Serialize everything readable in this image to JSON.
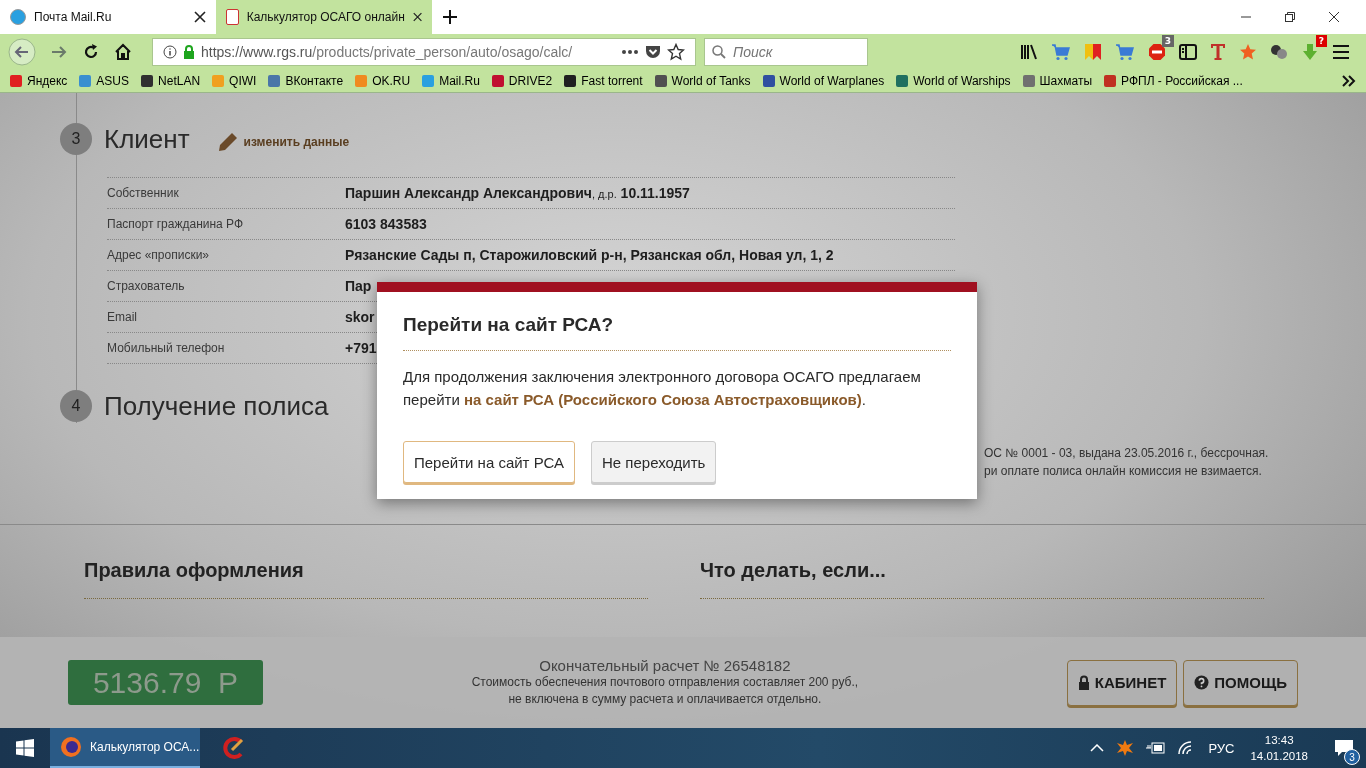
{
  "browser": {
    "tabs": [
      {
        "title": "Почта Mail.Ru",
        "selected": false
      },
      {
        "title": "Калькулятор ОСАГО онлайн",
        "selected": true
      }
    ],
    "url_host": "https://www.rgs.ru",
    "url_path": "/products/private_person/auto/osago/calc/",
    "search": {
      "placeholder": "Поиск"
    },
    "toolbar_badges": [
      {
        "text": "3"
      },
      {
        "text": "?"
      }
    ],
    "bookmarks": [
      {
        "label": "Яндекс",
        "color": "#e02020"
      },
      {
        "label": "ASUS",
        "color": "#3a8fd0"
      },
      {
        "label": "NetLAN",
        "color": "#303030"
      },
      {
        "label": "QIWI",
        "color": "#f0a020"
      },
      {
        "label": "ВКонтакте",
        "color": "#4a76a8"
      },
      {
        "label": "OK.RU",
        "color": "#f08a20"
      },
      {
        "label": "Mail.Ru",
        "color": "#2aa0e0"
      },
      {
        "label": "DRIVE2",
        "color": "#c01030"
      },
      {
        "label": "Fast torrent",
        "color": "#202020"
      },
      {
        "label": "World of Tanks",
        "color": "#505050"
      },
      {
        "label": "World of Warplanes",
        "color": "#3050a0"
      },
      {
        "label": "World of Warships",
        "color": "#207060"
      },
      {
        "label": "Шахматы",
        "color": "#707070"
      },
      {
        "label": "РФПЛ - Российская ...",
        "color": "#c03020"
      }
    ]
  },
  "page": {
    "section3": {
      "number": "3",
      "title": "Клиент",
      "edit_link": "изменить данные",
      "rows": [
        {
          "label": "Собственник",
          "value": "Паршин Александр Александрович",
          "note": ", д.р.",
          "extra": "10.11.1957"
        },
        {
          "label": "Паспорт гражданина РФ",
          "value": "6103 843583"
        },
        {
          "label": "Адрес «прописки»",
          "value": "Рязанские Сады п, Старожиловский р-н, Рязанская обл, Новая ул, 1, 2"
        },
        {
          "label": "Страхователь",
          "value": "Пар"
        },
        {
          "label": "Email",
          "value": "skor"
        },
        {
          "label": "Мобильный телефон",
          "value": "+791"
        }
      ]
    },
    "section4": {
      "number": "4",
      "title": "Получение полиса"
    },
    "license_lines": [
      "ОС № 0001 - 03, выдана 23.05.2016 г., бессрочная.",
      "ри оплате полиса онлайн комиссия не взимается."
    ],
    "columns": [
      {
        "title": "Правила оформления"
      },
      {
        "title": "Что делать, если..."
      }
    ]
  },
  "bottom_bar": {
    "price": "5136.79  Р",
    "calc_title": "Окончательный расчет № 26548182",
    "calc_note_1": "Стоимость обеспечения почтового отправления составляет 200 руб.,",
    "calc_note_2": "не включена в сумму расчета и оплачивается отдельно.",
    "buttons": [
      {
        "label": "КАБИНЕТ",
        "kind": "lock"
      },
      {
        "label": "ПОМОЩЬ",
        "kind": "help"
      }
    ]
  },
  "dialog": {
    "title": "Перейти на сайт РСА?",
    "text": "Для продолжения заключения электронного договора ОСАГО предлагаем перейти ",
    "link": "на сайт РСА (Российского Союза Автостраховщиков)",
    "text_end": ".",
    "buttons": [
      {
        "label": "Перейти на сайт РСА",
        "kind": "primary"
      },
      {
        "label": "Не переходить",
        "kind": "secondary"
      }
    ]
  },
  "taskbar": {
    "app_title": "Калькулятор ОСА...",
    "language": "РУС",
    "time": "13:43",
    "date": "14.01.2018",
    "notifications": "3"
  }
}
